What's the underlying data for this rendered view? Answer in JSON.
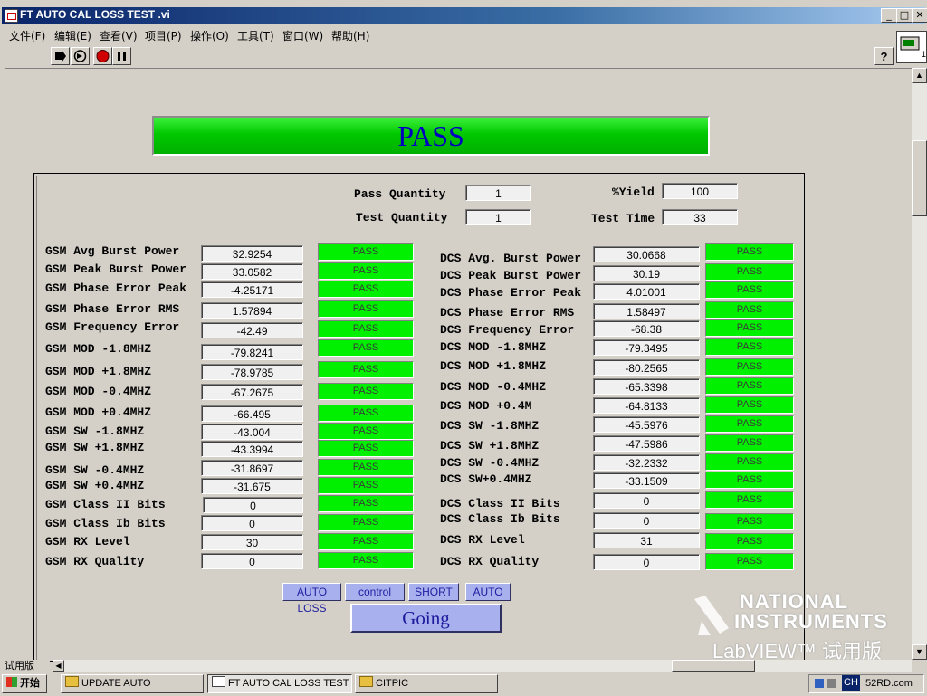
{
  "window": {
    "title": "FT AUTO CAL LOSS TEST .vi",
    "minimize": "_",
    "restore": "□",
    "close": "✕"
  },
  "menu": [
    "文件(F)",
    "编辑(E)",
    "查看(V)",
    "项目(P)",
    "操作(O)",
    "工具(T)",
    "窗口(W)",
    "帮助(H)"
  ],
  "banner": {
    "text": "PASS",
    "color": "#00c800"
  },
  "summary": {
    "pass_quantity_label": "Pass Quantity",
    "pass_quantity": "1",
    "test_quantity_label": "Test Quantity",
    "test_quantity": "1",
    "yield_label": "%Yield",
    "yield": "100",
    "test_time_label": "Test Time",
    "test_time": "33"
  },
  "gsm": [
    {
      "label": "GSM Avg Burst Power",
      "value": "32.9254",
      "status": "PASS"
    },
    {
      "label": "GSM Peak Burst Power",
      "value": "33.0582",
      "status": "PASS"
    },
    {
      "label": "GSM Phase Error Peak",
      "value": "-4.25171",
      "status": "PASS"
    },
    {
      "label": "GSM Phase Error RMS",
      "value": "1.57894",
      "status": "PASS"
    },
    {
      "label": "GSM Frequency Error",
      "value": "-42.49",
      "status": "PASS"
    },
    {
      "label": "GSM MOD -1.8MHZ",
      "value": "-79.8241",
      "status": "PASS"
    },
    {
      "label": "GSM MOD +1.8MHZ",
      "value": "-78.9785",
      "status": "PASS"
    },
    {
      "label": "GSM MOD -0.4MHZ",
      "value": "-67.2675",
      "status": "PASS"
    },
    {
      "label": "GSM MOD +0.4MHZ",
      "value": "-66.495",
      "status": "PASS"
    },
    {
      "label": "GSM SW -1.8MHZ",
      "value": "-43.004",
      "status": "PASS"
    },
    {
      "label": "GSM SW +1.8MHZ",
      "value": "-43.3994",
      "status": "PASS"
    },
    {
      "label": "GSM SW -0.4MHZ",
      "value": "-31.8697",
      "status": "PASS"
    },
    {
      "label": "GSM SW +0.4MHZ",
      "value": "-31.675",
      "status": "PASS"
    },
    {
      "label": "GSM Class II Bits",
      "value": "0",
      "status": "PASS"
    },
    {
      "label": "GSM Class Ib Bits",
      "value": "0",
      "status": "PASS"
    },
    {
      "label": "GSM RX Level",
      "value": "30",
      "status": "PASS"
    },
    {
      "label": "GSM RX Quality",
      "value": "0",
      "status": "PASS"
    }
  ],
  "dcs": [
    {
      "label": "DCS Avg. Burst Power",
      "value": "30.0668",
      "status": "PASS"
    },
    {
      "label": "DCS Peak Burst Power",
      "value": "30.19",
      "status": "PASS"
    },
    {
      "label": "DCS Phase Error Peak",
      "value": "4.01001",
      "status": "PASS"
    },
    {
      "label": "DCS Phase Error RMS",
      "value": "1.58497",
      "status": "PASS"
    },
    {
      "label": "DCS Frequency Error",
      "value": "-68.38",
      "status": "PASS"
    },
    {
      "label": "DCS MOD -1.8MHZ",
      "value": "-79.3495",
      "status": "PASS"
    },
    {
      "label": "DCS MOD +1.8MHZ",
      "value": "-80.2565",
      "status": "PASS"
    },
    {
      "label": "DCS MOD -0.4MHZ",
      "value": "-65.3398",
      "status": "PASS"
    },
    {
      "label": "DCS MOD +0.4M",
      "value": "-64.8133",
      "status": "PASS"
    },
    {
      "label": "DCS SW -1.8MHZ",
      "value": "-45.5976",
      "status": "PASS"
    },
    {
      "label": "DCS SW +1.8MHZ",
      "value": "-47.5986",
      "status": "PASS"
    },
    {
      "label": "DCS SW -0.4MHZ",
      "value": "-32.2332",
      "status": "PASS"
    },
    {
      "label": "DCS SW+0.4MHZ",
      "value": "-33.1509",
      "status": "PASS"
    },
    {
      "label": "DCS Class II Bits",
      "value": "0",
      "status": "PASS"
    },
    {
      "label": "DCS Class Ib Bits",
      "value": "0",
      "status": "PASS"
    },
    {
      "label": "DCS RX Level",
      "value": "31",
      "status": "PASS"
    },
    {
      "label": "DCS RX Quality",
      "value": "0",
      "status": "PASS"
    }
  ],
  "buttons": {
    "auto_loss": "AUTO LOSS",
    "control": "control",
    "short": "SHORT",
    "auto": "AUTO",
    "going": "Going"
  },
  "logo": {
    "line1": "NATIONAL",
    "line2": "INSTRUMENTS",
    "line3": "LabVIEW™ 试用版"
  },
  "status_tab": "试用版",
  "taskbar": {
    "start": "开始",
    "tasks": [
      "UPDATE AUTO",
      "FT AUTO CAL LOSS TEST .vi",
      "CITPIC"
    ],
    "tray_lang": "CH",
    "tray_site": "52RD.com"
  }
}
